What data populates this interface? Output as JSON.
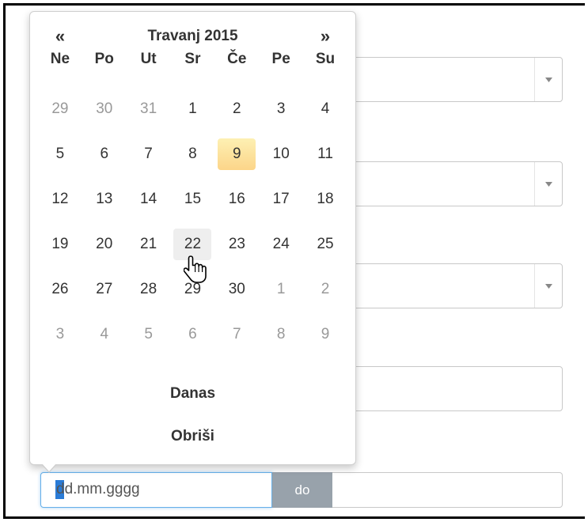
{
  "datepicker": {
    "prev_label": "«",
    "next_label": "»",
    "month_title": "Travanj 2015",
    "days_of_week": [
      "Ne",
      "Po",
      "Ut",
      "Sr",
      "Če",
      "Pe",
      "Su"
    ],
    "weeks": [
      [
        {
          "label": "29",
          "muted": true
        },
        {
          "label": "30",
          "muted": true
        },
        {
          "label": "31",
          "muted": true
        },
        {
          "label": "1"
        },
        {
          "label": "2"
        },
        {
          "label": "3"
        },
        {
          "label": "4"
        }
      ],
      [
        {
          "label": "5"
        },
        {
          "label": "6"
        },
        {
          "label": "7"
        },
        {
          "label": "8"
        },
        {
          "label": "9",
          "today": true
        },
        {
          "label": "10"
        },
        {
          "label": "11"
        }
      ],
      [
        {
          "label": "12"
        },
        {
          "label": "13"
        },
        {
          "label": "14"
        },
        {
          "label": "15"
        },
        {
          "label": "16"
        },
        {
          "label": "17"
        },
        {
          "label": "18"
        }
      ],
      [
        {
          "label": "19"
        },
        {
          "label": "20"
        },
        {
          "label": "21"
        },
        {
          "label": "22",
          "hover": true
        },
        {
          "label": "23"
        },
        {
          "label": "24"
        },
        {
          "label": "25"
        }
      ],
      [
        {
          "label": "26"
        },
        {
          "label": "27"
        },
        {
          "label": "28"
        },
        {
          "label": "29"
        },
        {
          "label": "30"
        },
        {
          "label": "1",
          "muted": true
        },
        {
          "label": "2",
          "muted": true
        }
      ],
      [
        {
          "label": "3",
          "muted": true
        },
        {
          "label": "4",
          "muted": true
        },
        {
          "label": "5",
          "muted": true
        },
        {
          "label": "6",
          "muted": true
        },
        {
          "label": "7",
          "muted": true
        },
        {
          "label": "8",
          "muted": true
        },
        {
          "label": "9",
          "muted": true
        }
      ]
    ],
    "today_button": "Danas",
    "clear_button": "Obriši"
  },
  "date_range": {
    "from_value": "dd.mm.gggg",
    "separator": "do",
    "to_value": ""
  },
  "colors": {
    "today_highlight": "#fcd589",
    "addon_bg": "#98a2ab",
    "focus_border": "#66afe9"
  },
  "icons": {
    "select_arrow": "triangle-down-icon",
    "cursor": "hand-pointer-icon"
  }
}
